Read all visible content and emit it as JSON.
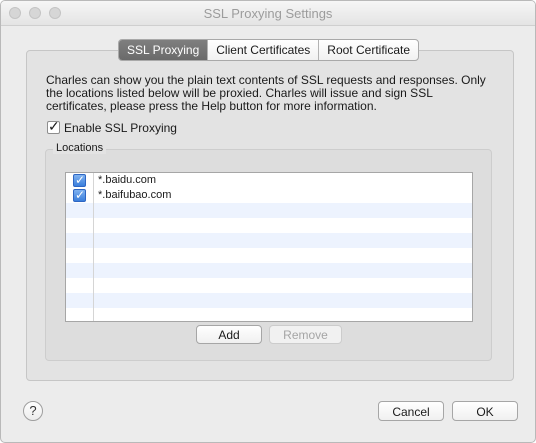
{
  "window": {
    "title": "SSL Proxying Settings"
  },
  "tabs": [
    {
      "label": "SSL Proxying",
      "active": true
    },
    {
      "label": "Client Certificates",
      "active": false
    },
    {
      "label": "Root Certificate",
      "active": false
    }
  ],
  "description": "Charles can show you the plain text contents of SSL requests and responses. Only the locations listed below will be proxied. Charles will issue and sign SSL certificates, please press the Help button for more information.",
  "enable_ssl": {
    "label": "Enable SSL Proxying",
    "checked": true
  },
  "locations": {
    "group_label": "Locations",
    "items": [
      {
        "host": "*.baidu.com",
        "enabled": true
      },
      {
        "host": "*.baifubao.com",
        "enabled": true
      }
    ],
    "add_label": "Add",
    "remove_label": "Remove"
  },
  "footer": {
    "help_label": "?",
    "cancel_label": "Cancel",
    "ok_label": "OK"
  },
  "colors": {
    "accent": "#3b7fdc",
    "row_alt": "#edf3fe"
  }
}
